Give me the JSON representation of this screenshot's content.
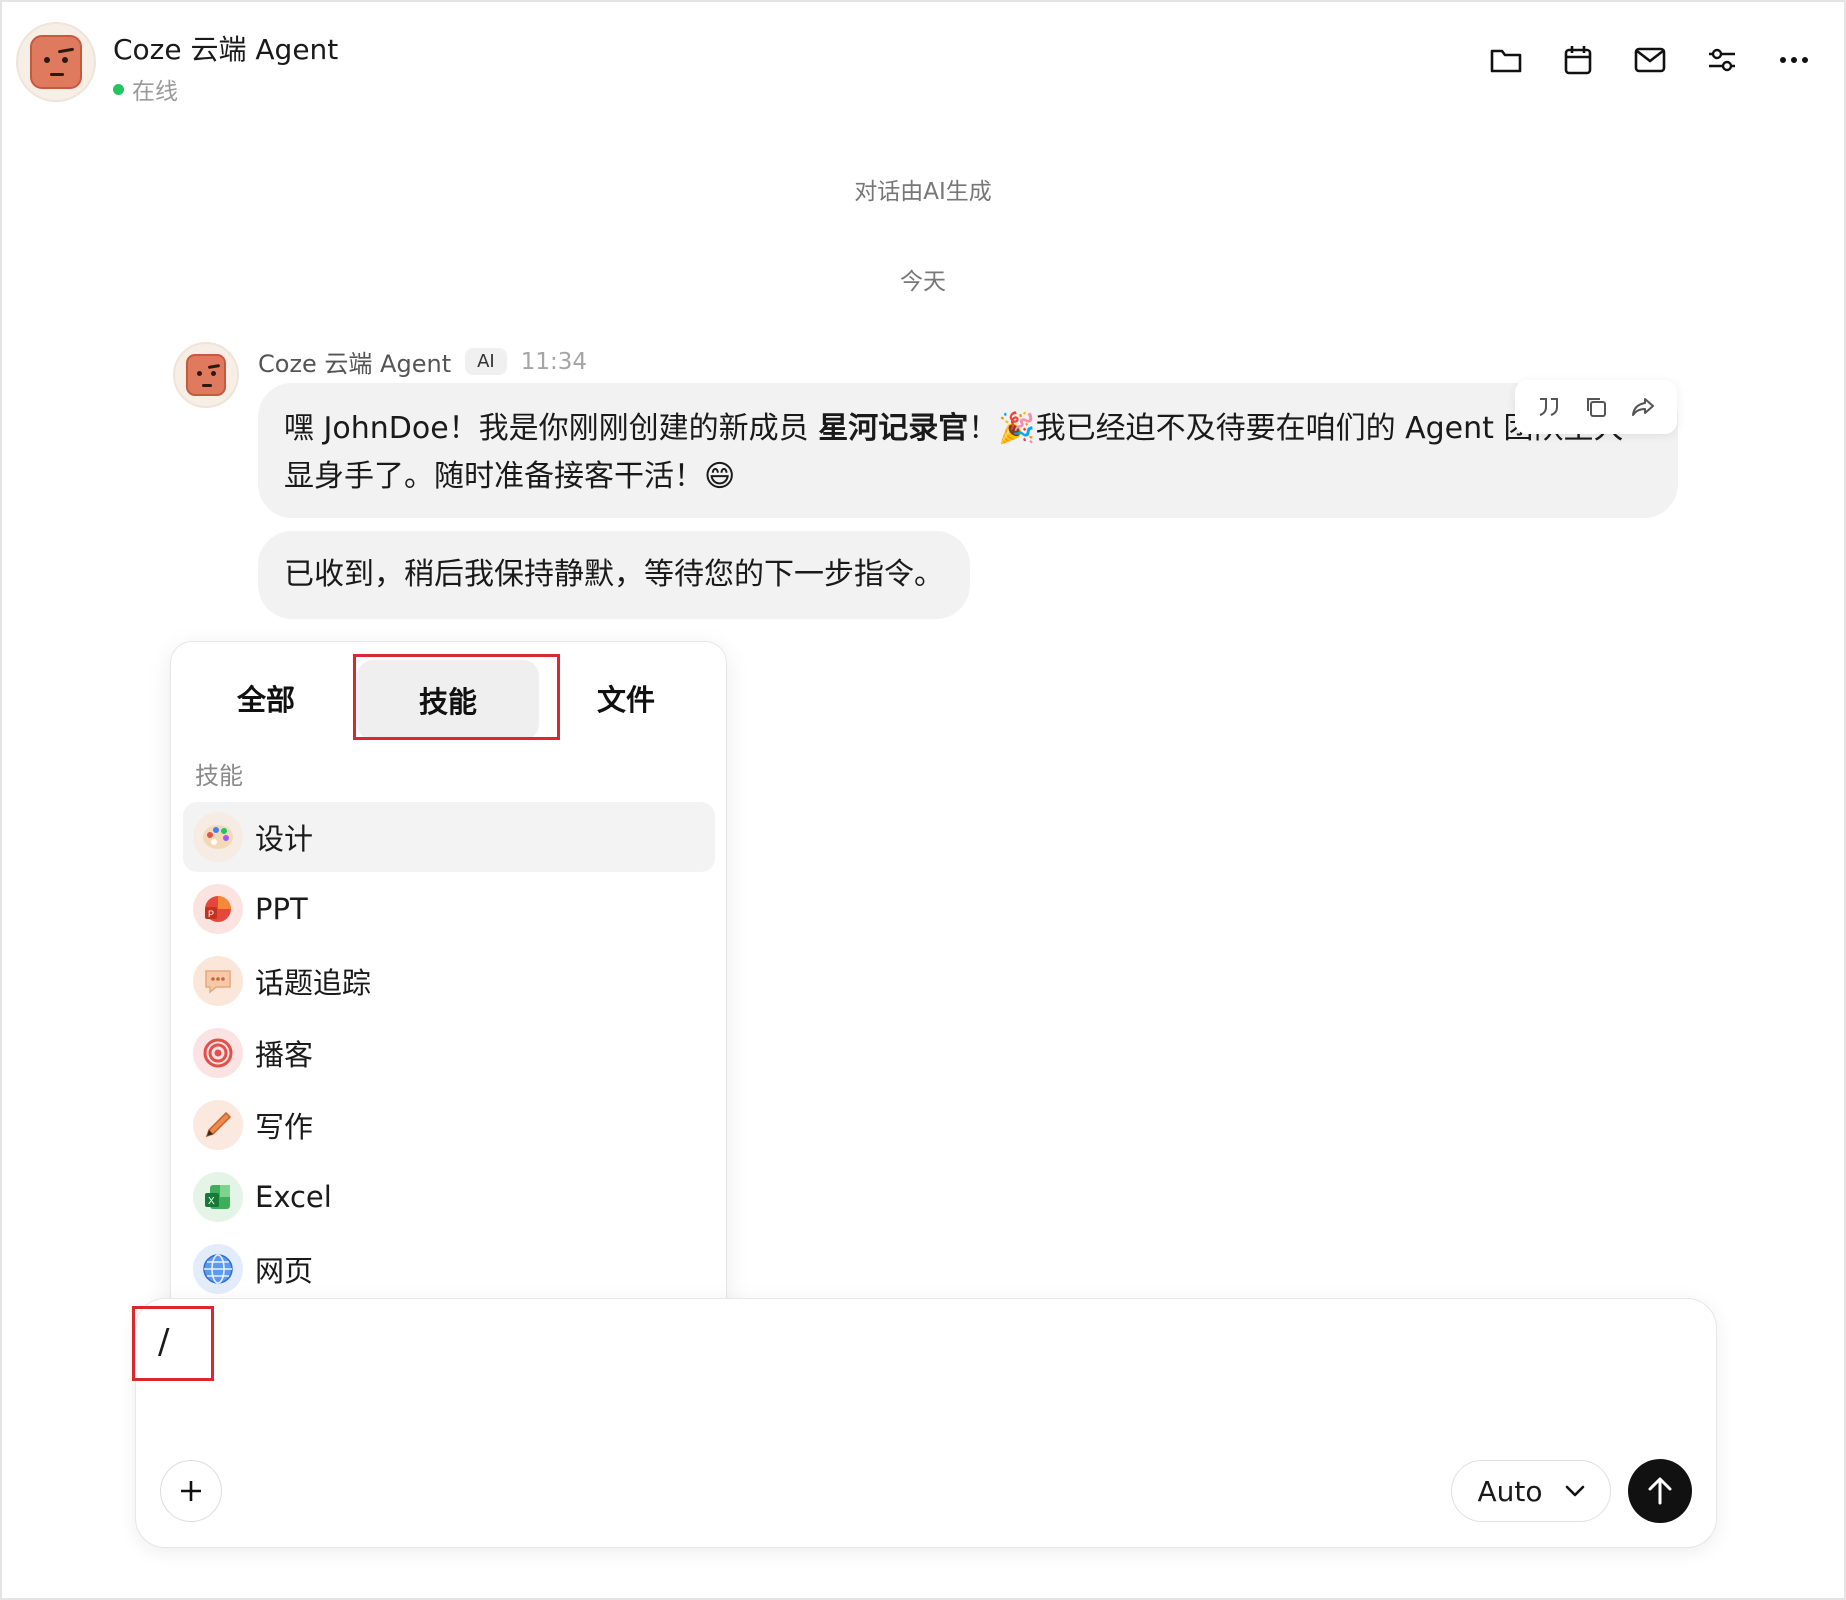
{
  "header": {
    "title": "Coze 云端 Agent",
    "status": "在线",
    "icons": [
      "folder-icon",
      "calendar-icon",
      "mail-icon",
      "settings-sliders-icon",
      "more-icon"
    ]
  },
  "chat": {
    "notice": "对话由AI生成",
    "date_divider": "今天",
    "message": {
      "sender": "Coze 云端 Agent",
      "badge": "AI",
      "time": "11:34",
      "part1": "嘿 JohnDoe！我是你刚刚创建的新成员 ",
      "bold": "星河记录官",
      "part2": "！🎉我已经迫不及待要在咱们的 Agent 团队里大显身手了。随时准备接客干活！😄",
      "reply": "已收到，稍后我保持静默，等待您的下一步指令。"
    }
  },
  "popup": {
    "tabs": [
      "全部",
      "技能",
      "文件"
    ],
    "active_tab": "技能",
    "section_label": "技能",
    "items": [
      {
        "label": "设计",
        "icon": "palette-icon",
        "color": "#f6ece4"
      },
      {
        "label": "PPT",
        "icon": "ppt-icon",
        "color": "#fbe4e0"
      },
      {
        "label": "话题追踪",
        "icon": "chat-bubble-icon",
        "color": "#fbe7da"
      },
      {
        "label": "播客",
        "icon": "podcast-icon",
        "color": "#fbe3e3"
      },
      {
        "label": "写作",
        "icon": "pencil-icon",
        "color": "#fbe9df"
      },
      {
        "label": "Excel",
        "icon": "excel-icon",
        "color": "#e4f4e6"
      },
      {
        "label": "网页",
        "icon": "globe-icon",
        "color": "#e2ecfb"
      }
    ]
  },
  "composer": {
    "value": "/",
    "model": "Auto"
  }
}
